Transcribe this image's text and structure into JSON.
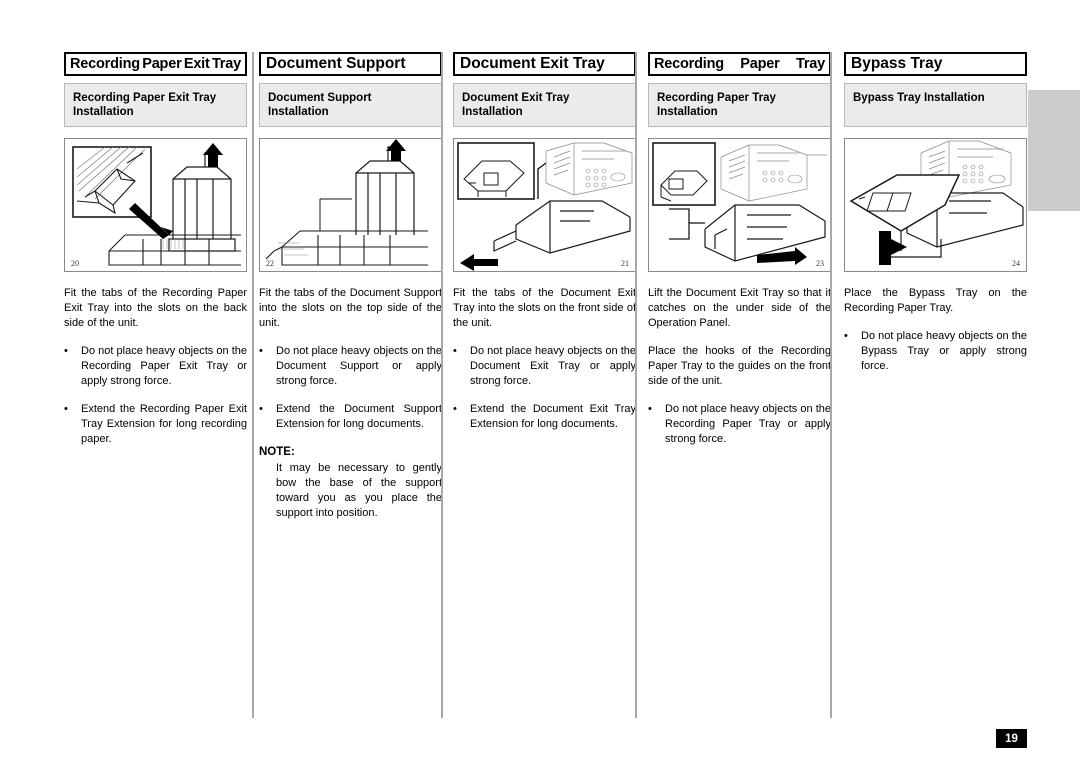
{
  "document": {
    "page_number": "19"
  },
  "columns": [
    {
      "title": "Recording Paper Exit Tray",
      "title_words": [
        "Recording",
        "Paper",
        "Exit",
        "Tray"
      ],
      "subtitle": "Recording Paper Exit Tray Installation",
      "figure_number": "20",
      "figure_number_align": "left",
      "paragraphs": [
        "Fit the tabs of the Recording Paper Exit Tray into the slots on the back side of the unit."
      ],
      "bullets": [
        "Do not place heavy objects on the Recording Paper Exit Tray or apply strong force.",
        "Extend the Recording Paper Exit Tray Extension for long recording paper."
      ],
      "note": null
    },
    {
      "title": "Document Support",
      "title_words": [
        "Document",
        "Support"
      ],
      "subtitle": "Document Support Installation",
      "figure_number": "22",
      "figure_number_align": "left",
      "paragraphs": [
        "Fit the tabs of the Document Support into the slots on the top side of the unit."
      ],
      "bullets": [
        "Do not place heavy objects on the Document Support or apply strong force.",
        "Extend the Document Support Extension for long documents."
      ],
      "note": {
        "heading": "NOTE:",
        "body": "It may be necessary to gently bow the base of the support toward you as you place the support into position."
      }
    },
    {
      "title": "Document Exit Tray",
      "title_words": [
        "Document",
        "Exit",
        "Tray"
      ],
      "subtitle": "Document Exit Tray Installation",
      "figure_number": "21",
      "figure_number_align": "right",
      "paragraphs": [
        "Fit the tabs of the Document Exit Tray into the slots on the front side of the unit."
      ],
      "bullets": [
        "Do not place heavy objects on the Document Exit Tray or apply strong force.",
        "Extend the Document Exit Tray Extension for long documents."
      ],
      "note": null
    },
    {
      "title": "Recording Paper Tray",
      "title_words": [
        "Recording",
        "Paper",
        "Tray"
      ],
      "subtitle": "Recording Paper Tray Installation",
      "figure_number": "23",
      "figure_number_align": "right",
      "paragraphs": [
        "Lift the Document Exit Tray so that it catches on the under side of the Operation Panel.",
        "Place the hooks of the Recording Paper Tray to the guides on the front side of the unit."
      ],
      "bullets": [
        "Do not place heavy objects on the Recording Paper Tray or apply strong force."
      ],
      "note": null
    },
    {
      "title": "Bypass Tray",
      "title_words": [
        "Bypass",
        "Tray"
      ],
      "subtitle": "Bypass Tray Installation",
      "figure_number": "24",
      "figure_number_align": "right",
      "paragraphs": [
        "Place the Bypass Tray on the Recording Paper Tray."
      ],
      "bullets": [
        "Do not place heavy objects on the Bypass Tray or apply strong force."
      ],
      "note": null
    }
  ],
  "bullet_glyph": "•",
  "colors": {
    "title_border": "#000000",
    "subtitle_background": "#ebebeb",
    "figure_border": "#8a8a8a",
    "separator": "#a8a8a8",
    "thumb_tab": "#cccccc",
    "page_badge": "#000000"
  }
}
